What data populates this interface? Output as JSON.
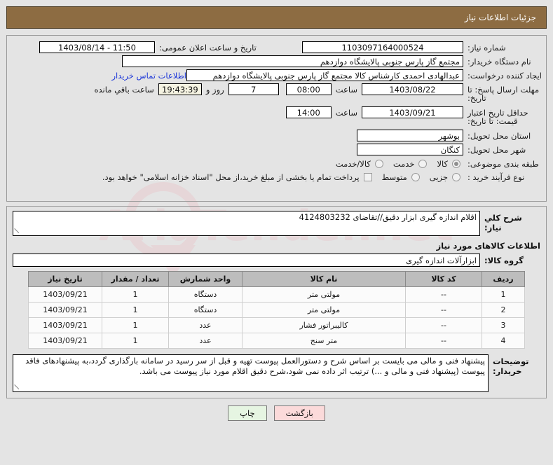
{
  "header": {
    "title": "جزئیات اطلاعات نیاز"
  },
  "form": {
    "need_number": {
      "label": "شماره نیاز:",
      "value": "1103097164000524"
    },
    "announce_datetime": {
      "label": "تاریخ و ساعت اعلان عمومی:",
      "value": "1403/08/14 - 11:50"
    },
    "buyer_org": {
      "label": "نام دستگاه خریدار:",
      "value": "مجتمع گاز پارس جنوبی  پالایشگاه دوازدهم"
    },
    "requester": {
      "label": "ایجاد کننده درخواست:",
      "value": "عبدالهادی احمدی کارشناس کالا مجتمع گاز پارس جنوبی  پالایشگاه دوازدهم"
    },
    "buyer_contact_link": "اطلاعات تماس خریدار",
    "response_deadline": {
      "label": "مهلت ارسال پاسخ: تا تاریخ:",
      "date": "1403/08/22",
      "time_label": "ساعت",
      "time": "08:00",
      "days": "7",
      "days_label": "روز و",
      "countdown": "19:43:39",
      "countdown_label": "ساعت باقي مانده"
    },
    "price_validity": {
      "label": "حداقل تاریخ اعتبار قیمت: تا تاریخ:",
      "date": "1403/09/21",
      "time_label": "ساعت",
      "time": "14:00"
    },
    "delivery_province": {
      "label": "استان محل تحویل:",
      "value": "بوشهر"
    },
    "delivery_city": {
      "label": "شهر محل تحویل:",
      "value": "کنگان"
    },
    "category": {
      "label": "طبقه بندی موضوعی:",
      "options": [
        "کالا",
        "خدمت",
        "کالا/خدمت"
      ],
      "selected": "کالا"
    },
    "process_type": {
      "label": "نوع فرآیند خرید :",
      "options": [
        "جزیی",
        "متوسط"
      ],
      "selected": "",
      "treasury_checkbox_label": "پرداخت تمام یا بخشی از مبلغ خرید،از محل \"اسناد خزانه اسلامی\" خواهد بود.",
      "treasury_checked": false
    }
  },
  "need_summary": {
    "label": "شرح کلي نياز:",
    "value": "اقلام اندازه گیری ابزار دقیق//تقاضای 4124803232"
  },
  "goods_section": {
    "title": "اطلاعات کالاهای مورد نیاز",
    "group_label": "گروه کالا:",
    "group_value": "ابزارآلات اندازه گیری"
  },
  "items_table": {
    "columns": [
      "ردیف",
      "کد کالا",
      "نام کالا",
      "واحد شمارش",
      "تعداد / مقدار",
      "تاریخ نیاز"
    ],
    "rows": [
      {
        "row": "1",
        "code": "--",
        "name": "مولتی متر",
        "unit": "دستگاه",
        "qty": "1",
        "date": "1403/09/21"
      },
      {
        "row": "2",
        "code": "--",
        "name": "مولتی متر",
        "unit": "دستگاه",
        "qty": "1",
        "date": "1403/09/21"
      },
      {
        "row": "3",
        "code": "--",
        "name": "کالیبراتور فشار",
        "unit": "عدد",
        "qty": "1",
        "date": "1403/09/21"
      },
      {
        "row": "4",
        "code": "--",
        "name": "متر سنج",
        "unit": "عدد",
        "qty": "1",
        "date": "1403/09/21"
      }
    ]
  },
  "buyer_notes": {
    "label": "توضیحات خریدار:",
    "value": "پیشنهاد فنی و مالی می بایست بر اساس شرح و دستورالعمل پیوست تهیه و قبل از سر رسید در سامانه بارگذاری گردد،به پیشنهادهای فاقد پیوست (پیشنهاد فنی و مالی و ...) ترتیب اثر داده نمی شود،شرح دقیق اقلام مورد نیاز پیوست می باشد."
  },
  "footer": {
    "print_label": "چاپ",
    "back_label": "بازگشت"
  },
  "watermark": {
    "text": "AriaTender.net"
  },
  "colors": {
    "header_bg": "#8d6c42",
    "link": "#1a35d8",
    "timer_bg": "#f5f3e2",
    "table_header_bg": "#bdbdbd",
    "print_btn_bg": "#e6f5e2",
    "back_btn_bg": "#fbdada"
  }
}
